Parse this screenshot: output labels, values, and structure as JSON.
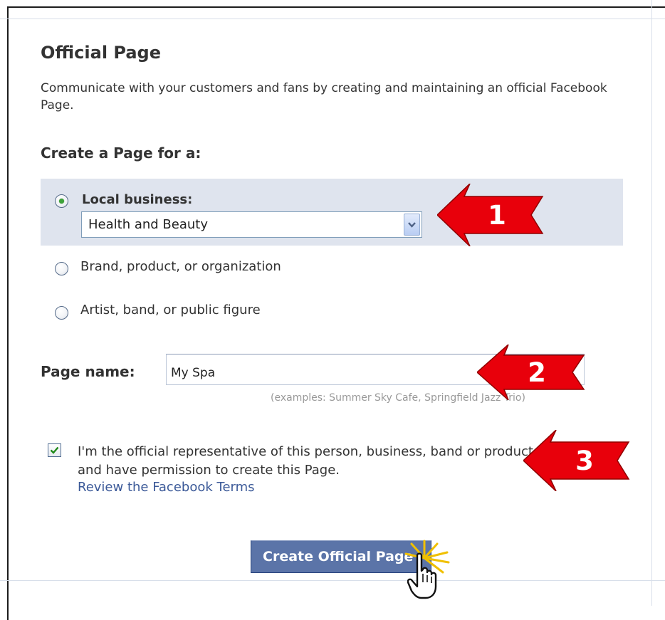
{
  "page": {
    "title": "Official Page",
    "description": "Communicate with your customers and fans by creating and maintaining an official Facebook Page.",
    "create_for_heading": "Create a Page for a:"
  },
  "page_type": {
    "options": [
      {
        "label": "Local business:",
        "selected": true
      },
      {
        "label": "Brand, product, or organization",
        "selected": false
      },
      {
        "label": "Artist, band, or public figure",
        "selected": false
      }
    ],
    "category_select": {
      "value": "Health and Beauty"
    }
  },
  "page_name": {
    "label": "Page name:",
    "value": "My Spa",
    "hint": "(examples: Summer Sky Cafe, Springfield Jazz Trio)"
  },
  "agreement": {
    "checked": true,
    "text": "I'm the official representative of this person, business, band or product and have permission to create this Page.",
    "link_text": "Review the Facebook Terms"
  },
  "submit": {
    "label": "Create Official Page"
  },
  "callouts": [
    {
      "number": "1"
    },
    {
      "number": "2"
    },
    {
      "number": "3"
    }
  ],
  "colors": {
    "accent": "#3b5998",
    "button": "#5b74a8",
    "highlight": "#dfe4ee",
    "callout_arrow": "#e8000b",
    "radio_selected": "#3ea33a"
  }
}
